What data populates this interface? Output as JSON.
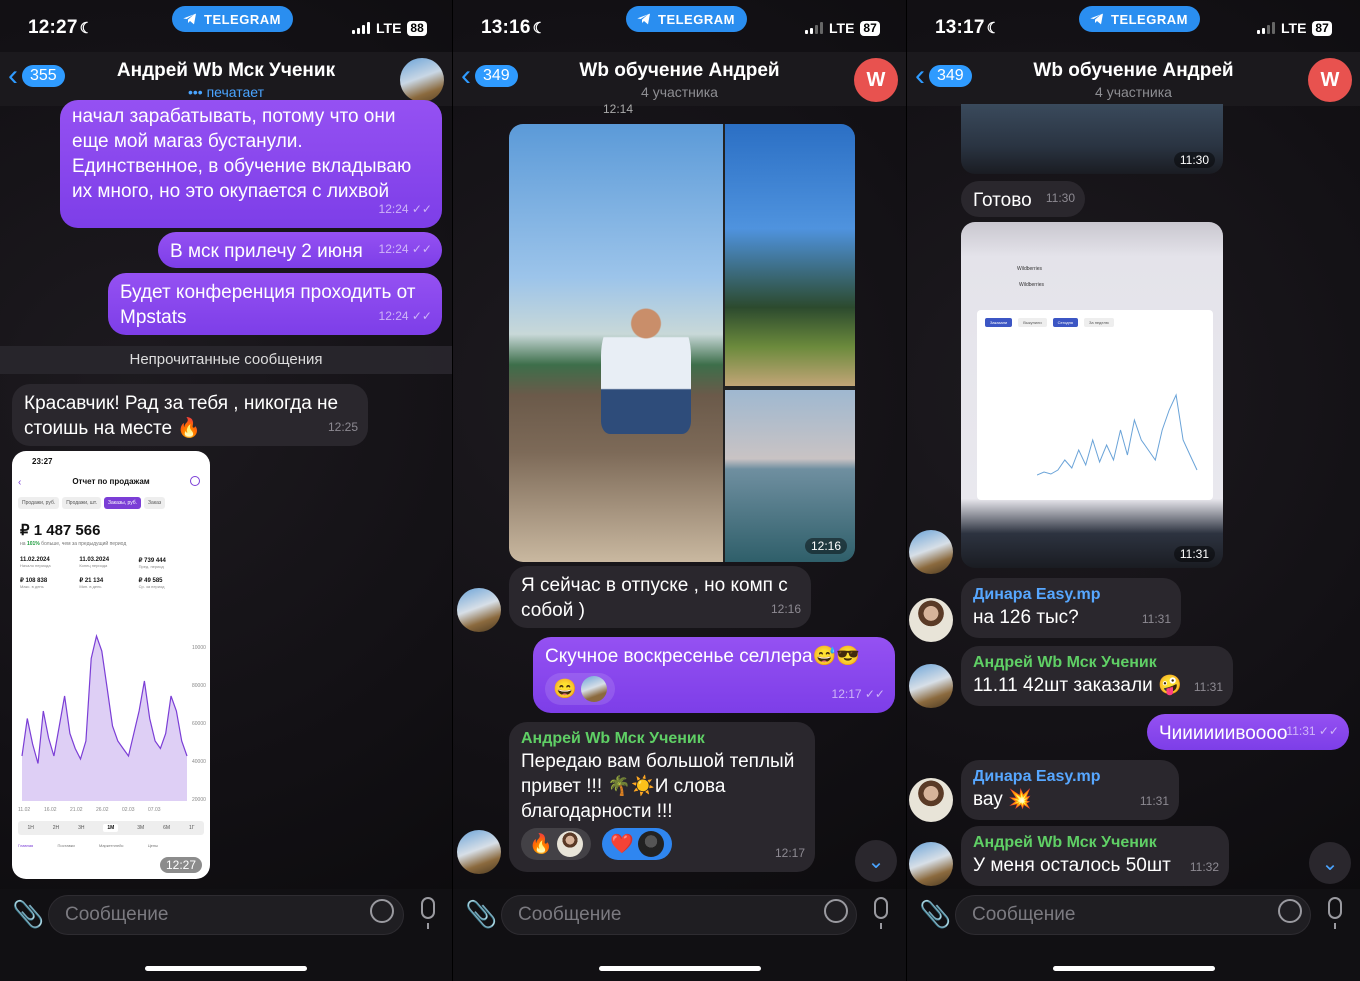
{
  "panel1": {
    "status": {
      "time": "12:27",
      "carrier": "TELEGRAM",
      "network": "LTE",
      "battery": "88"
    },
    "header": {
      "back_count": "355",
      "title": "Андрей Wb Мск Ученик",
      "subtitle": "печатает"
    },
    "messages": [
      {
        "text": "начал зарабатывать, потому что они еще мой магаз бустанули. Единственное, в обучение вкладываю их много, но это окупается с лихвой",
        "time": "12:24"
      },
      {
        "text": "В мск прилечу 2 июня",
        "time": "12:24"
      },
      {
        "text": "Будет конференция проходить от Mpstats",
        "time": "12:24"
      }
    ],
    "unread_label": "Непрочитанные сообщения",
    "incoming": {
      "text": "Красавчик! Рад за тебя , никогда не стоишь на месте 🔥",
      "time": "12:25"
    },
    "screenshot": {
      "time_label": "23:27",
      "title": "Отчет по продажам",
      "tabs": [
        "Продажи, руб.",
        "Продажи, шт.",
        "Заказы, руб.",
        "Заказ"
      ],
      "total": "₽ 1 487 566",
      "note_prefix": "на ",
      "note_pct": "101%",
      "note_rest": " больше, чем за предыдущий период",
      "stats": [
        {
          "v": "11.02.2024",
          "l": "Начало периода"
        },
        {
          "v": "11.03.2024",
          "l": "Конец периода"
        },
        {
          "v": "₽ 739 444",
          "l": "Пред. период"
        },
        {
          "v": "₽ 108 838",
          "l": "Макс. в день"
        },
        {
          "v": "₽ 21 134",
          "l": "Мин. в день"
        },
        {
          "v": "₽ 49 585",
          "l": "Ср. за период"
        }
      ],
      "y_ticks": [
        "100000",
        "80000",
        "60000",
        "40000",
        "20000"
      ],
      "x_ticks": [
        "11.02",
        "16.02",
        "21.02",
        "26.02",
        "02.03",
        "07.03"
      ],
      "periods": [
        "1Н",
        "2Н",
        "3Н",
        "1М",
        "3М",
        "6М",
        "1Г"
      ],
      "nav": [
        "Главная",
        "Поставки",
        "Маркетплейс",
        "Цены"
      ],
      "time": "12:27"
    },
    "composer_placeholder": "Сообщение"
  },
  "panel2": {
    "status": {
      "time": "13:16",
      "carrier": "TELEGRAM",
      "network": "LTE",
      "battery": "87"
    },
    "header": {
      "back_count": "349",
      "title": "Wb обучение Андрей",
      "subtitle": "4 участника",
      "avatar_letter": "W"
    },
    "top_time": "12:14",
    "album_time": "12:16",
    "msg1": {
      "text": "Я сейчас в отпуске , но комп с собой )",
      "time": "12:16"
    },
    "msg2": {
      "text": "Скучное воскресенье селлера😅😎",
      "time": "12:17"
    },
    "msg3": {
      "sender": "Андрей Wb Мск Ученик",
      "text": "Передаю вам большой теплый привет !!! 🌴☀️И слова благодарности !!!",
      "time": "12:17"
    },
    "composer_placeholder": "Сообщение"
  },
  "panel3": {
    "status": {
      "time": "13:17",
      "carrier": "TELEGRAM",
      "network": "LTE",
      "battery": "87"
    },
    "header": {
      "back_count": "349",
      "title": "Wb обучение Андрей",
      "subtitle": "4 участника",
      "avatar_letter": "W"
    },
    "photo1_time": "11:30",
    "msg_ready": {
      "text": "Готово",
      "time": "11:30"
    },
    "photo2_time": "11:31",
    "laptop": {
      "browser_tab": "Wildberries",
      "app_name": "Wildberries",
      "toggles": [
        "Заказали",
        "Выкупили",
        "Сегодня",
        "За неделю"
      ]
    },
    "msgs": [
      {
        "sender": "Динара Easy.mp",
        "text": "на 126 тыс?",
        "time": "11:31",
        "color": "blue"
      },
      {
        "sender": "Андрей Wb Мск Ученик",
        "text": "11.11 42шт заказали 🤪",
        "time": "11:31",
        "color": "green"
      },
      {
        "sender": "",
        "text": "Чиииииивоооо",
        "time": "11:31",
        "color": "out"
      },
      {
        "sender": "Динара Easy.mp",
        "text": "вау 💥",
        "time": "11:31",
        "color": "blue"
      },
      {
        "sender": "Андрей Wb Мск Ученик",
        "text": "У меня осталось 50шт",
        "time": "11:32",
        "color": "green"
      }
    ],
    "composer_placeholder": "Сообщение"
  }
}
